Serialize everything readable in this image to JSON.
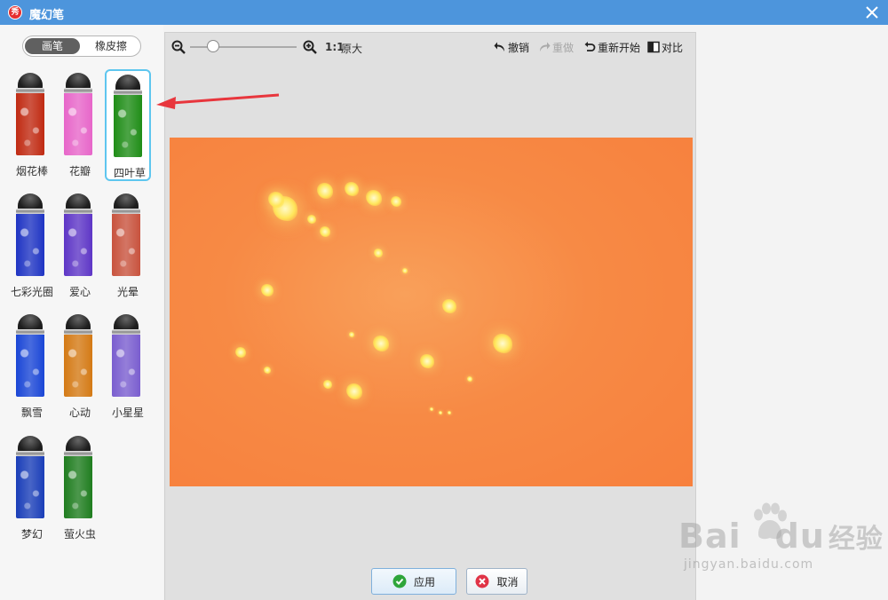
{
  "window": {
    "title": "魔幻笔",
    "app_icon_text": "秀",
    "close_icon": "close-icon"
  },
  "mode_toggle": {
    "brush_label": "画笔",
    "eraser_label": "橡皮擦",
    "active": "画笔"
  },
  "brushes": [
    {
      "label": "烟花棒",
      "selected": false,
      "color": "#c02a12"
    },
    {
      "label": "花瓣",
      "selected": false,
      "color": "#e766c9"
    },
    {
      "label": "四叶草",
      "selected": true,
      "color": "#1f8d17"
    },
    {
      "label": "七彩光圈",
      "selected": false,
      "color": "#1f34c3"
    },
    {
      "label": "爱心",
      "selected": false,
      "color": "#5e36c6"
    },
    {
      "label": "光晕",
      "selected": false,
      "color": "#c8533e"
    },
    {
      "label": "飘雪",
      "selected": false,
      "color": "#1a46d6"
    },
    {
      "label": "心动",
      "selected": false,
      "color": "#d47a15"
    },
    {
      "label": "小星星",
      "selected": false,
      "color": "#7a5ecf"
    },
    {
      "label": "梦幻",
      "selected": false,
      "color": "#1a3eb8"
    },
    {
      "label": "萤火虫",
      "selected": false,
      "color": "#1f7d1f"
    }
  ],
  "toolbar": {
    "zoom_ratio": "1:1",
    "actual_size": "原大",
    "zoom_level": 0.22,
    "undo": "撤销",
    "redo": "重做",
    "restart": "重新开始",
    "compare": "对比"
  },
  "canvas": {
    "background_color": "#f7863f",
    "stroke_color": "#ffe65a"
  },
  "buttons": {
    "apply": "应用",
    "cancel": "取消"
  },
  "watermark": {
    "brand": "Bai",
    "brand_end": "du",
    "cn": "经验",
    "url": "jingyan.baidu.com"
  }
}
